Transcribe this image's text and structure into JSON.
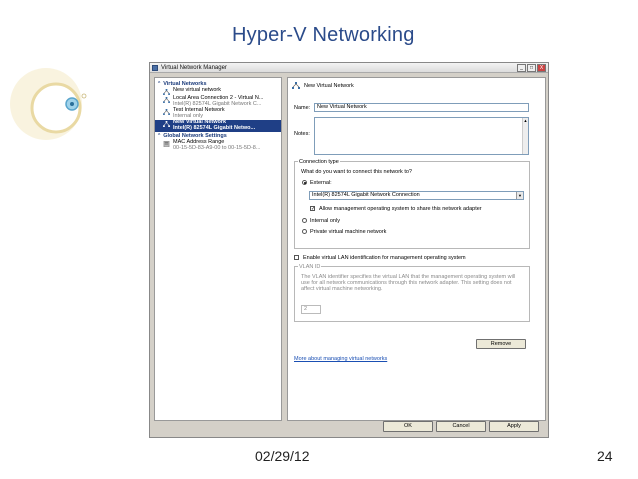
{
  "slide": {
    "title": "Hyper-V Networking",
    "date": "02/29/12",
    "page": "24"
  },
  "window": {
    "title": "Virtual Network Manager",
    "min_label": "_",
    "max_label": "□",
    "close_label": "X"
  },
  "left": {
    "virtual_networks_header": "Virtual Networks",
    "items": [
      {
        "main": "New virtual network",
        "sub": ""
      },
      {
        "main": "Local Area Connection 2 - Virtual N...",
        "sub": "Intel(R) 82574L Gigabit Network C..."
      },
      {
        "main": "Test Internal Network",
        "sub": "Internal only"
      },
      {
        "main": "New Virtual Network",
        "sub": "Intel(R) 82574L Gigabit Netwo..."
      }
    ],
    "global_header": "Global Network Settings",
    "mac": {
      "main": "MAC Address Range",
      "sub": "00-15-5D-83-A9-00 to 00-15-5D-8..."
    }
  },
  "right": {
    "heading": "New Virtual Network",
    "name_label": "Name:",
    "name_value": "New Virtual Network",
    "notes_label": "Notes:",
    "conn_type_title": "Connection type",
    "conn_question": "What do you want to connect this network to?",
    "external_label": "External:",
    "adapter_value": "Intel(R) 82574L Gigabit Network Connection",
    "allow_label": "Allow management operating system to share this network adapter",
    "internal_label": "Internal only",
    "private_label": "Private virtual machine network",
    "vlan_enable_label": "Enable virtual LAN identification for management operating system",
    "vlan_group_title": "VLAN ID",
    "vlan_desc": "The VLAN identifier specifies the virtual LAN that the management operating system will use for all network communications through this network adapter. This setting does not affect virtual machine networking.",
    "vlan_value": "2",
    "remove_label": "Remove",
    "more_link": "More about managing virtual networks"
  },
  "footer_buttons": {
    "ok": "OK",
    "cancel": "Cancel",
    "apply": "Apply"
  },
  "colors": {
    "title": "#2b4b8a",
    "selection": "#1f3f86",
    "link": "#1a4fb3"
  }
}
